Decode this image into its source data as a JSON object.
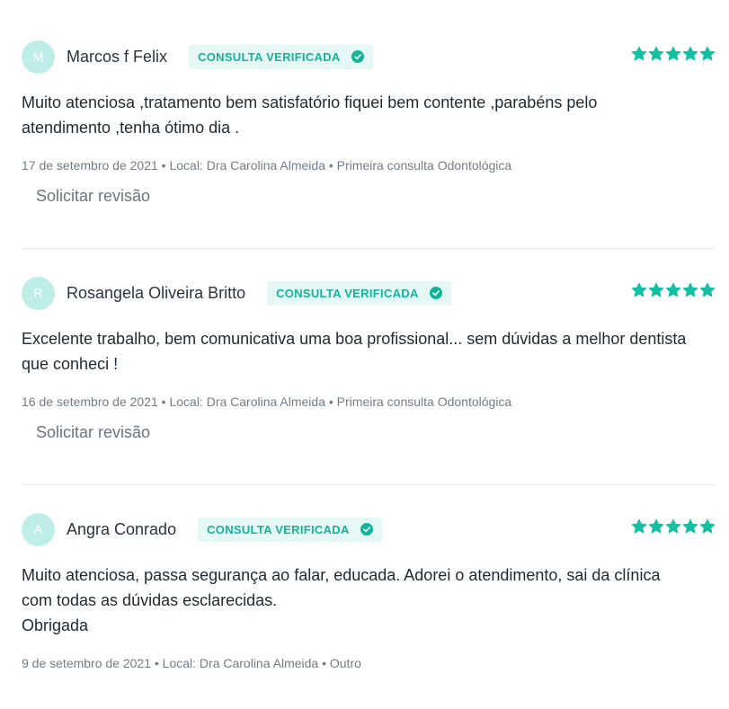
{
  "reviews": [
    {
      "initial": "M",
      "name": "Marcos f Felix",
      "badge": "CONSULTA VERIFICADA",
      "rating": 5,
      "text_lines": [
        "Muito atenciosa ,tratamento bem satisfatório fiquei bem contente ,parabéns pelo",
        "atendimento ,tenha ótimo dia ."
      ],
      "meta": "17 de setembro de 2021 • Local: Dra Carolina Almeida • Primeira consulta Odontológica",
      "revision_label": "Solicitar revisão"
    },
    {
      "initial": "R",
      "name": "Rosangela Oliveira Britto",
      "badge": "CONSULTA VERIFICADA",
      "rating": 5,
      "text_lines": [
        "Excelente trabalho, bem comunicativa uma boa profissional... sem dúvidas a melhor dentista",
        "que conheci !"
      ],
      "meta": "16 de setembro de 2021 • Local: Dra Carolina Almeida • Primeira consulta Odontológica",
      "revision_label": "Solicitar revisão"
    },
    {
      "initial": "A",
      "name": "Angra Conrado",
      "badge": "CONSULTA VERIFICADA",
      "rating": 5,
      "text_lines": [
        "Muito atenciosa, passa segurança ao falar, educada. Adorei o atendimento, sai da clínica",
        "com todas as dúvidas esclarecidas.",
        "Obrigada"
      ],
      "meta": "9 de setembro de 2021 • Local: Dra Carolina Almeida • Outro"
    }
  ],
  "colors": {
    "accent": "#14b39a",
    "badge_bg": "#e6f8f5",
    "avatar_bg": "#bfeee8",
    "star": "#14c0a3"
  },
  "icons": {
    "badge": "check-circle-icon",
    "rating": "star-icon"
  }
}
